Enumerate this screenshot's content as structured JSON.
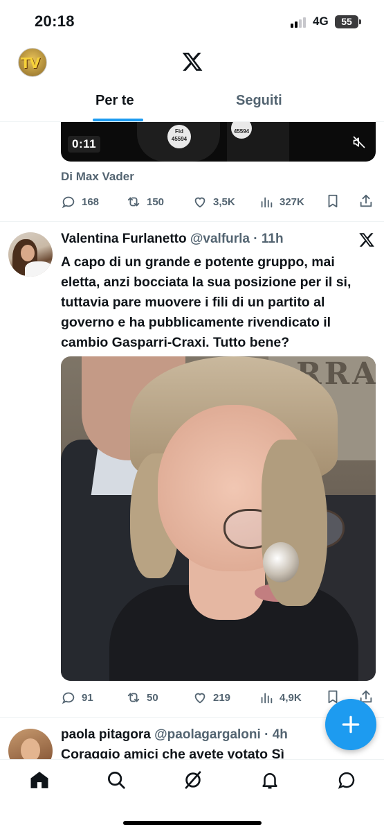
{
  "status_bar": {
    "time": "20:18",
    "network": "4G",
    "battery": "55"
  },
  "header": {
    "logo": "x-logo",
    "tabs": [
      {
        "label": "Per te",
        "active": true
      },
      {
        "label": "Seguiti",
        "active": false
      }
    ]
  },
  "tweet1": {
    "video_time": "0:11",
    "badge1_line1": "Fid",
    "badge1_line2": "45594",
    "badge2_text": "45594",
    "byline": "Di Max Vader",
    "stats": {
      "replies": "168",
      "retweets": "150",
      "likes": "3,5K",
      "views": "327K"
    }
  },
  "tweet2": {
    "name": "Valentina Furlanetto",
    "handle": "@valfurla",
    "time": "· 11h",
    "text": "A capo di un grande e potente gruppo, mai eletta, anzi bocciata la sua posizione per il si, tuttavia pare muovere i fili di un partito al governo e ha pubblicamente rivendicato il cambio Gasparri-Craxi. Tutto bene?",
    "photo_wall_text": "RRA",
    "stats": {
      "replies": "91",
      "retweets": "50",
      "likes": "219",
      "views": "4,9K"
    }
  },
  "tweet3": {
    "name": "paola pitagora",
    "handle": "@paolagargaloni",
    "time": "· 4h",
    "text": "Coraggio amici che avete votato Sì"
  },
  "colors": {
    "accent": "#1d9bf0",
    "text": "#0f1419",
    "secondary": "#536471"
  },
  "nav": [
    "home-icon",
    "search-icon",
    "grok-icon",
    "notifications-icon",
    "messages-icon"
  ]
}
